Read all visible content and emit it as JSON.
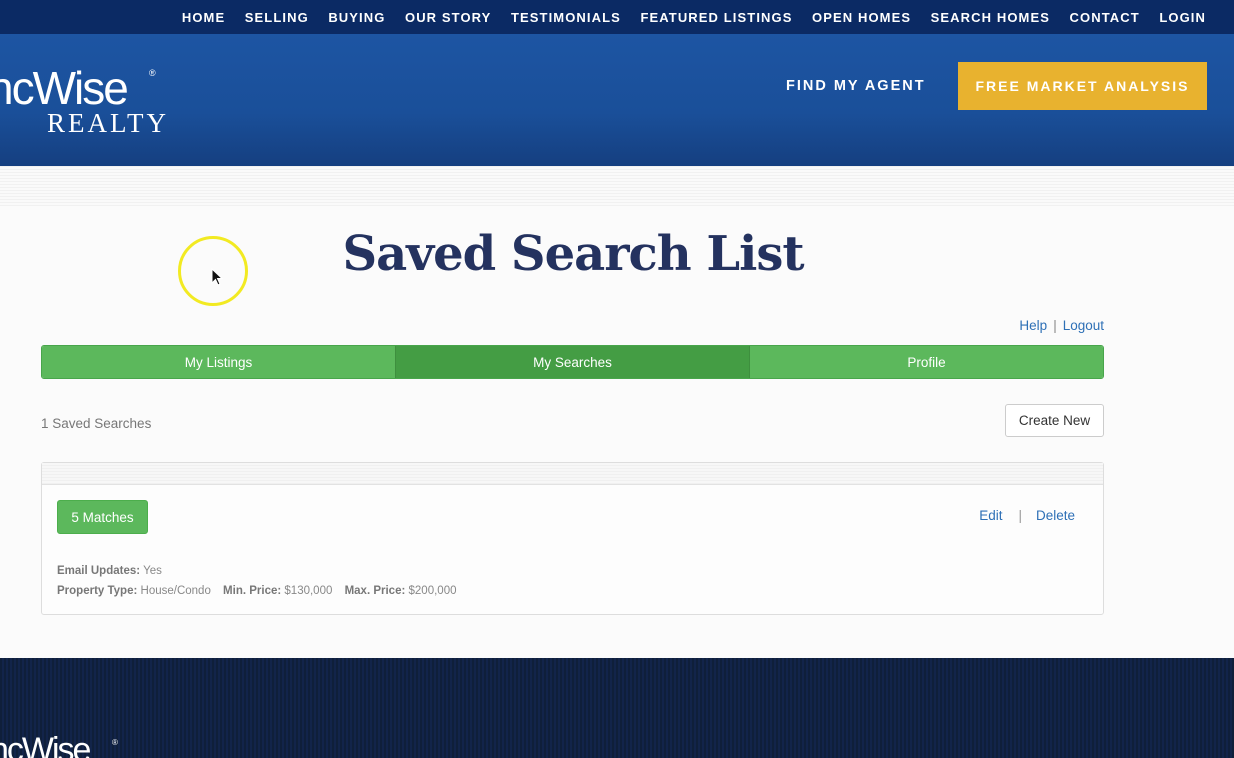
{
  "topnav": {
    "items": [
      "HOME",
      "SELLING",
      "BUYING",
      "OUR STORY",
      "TESTIMONIALS",
      "FEATURED LISTINGS",
      "OPEN HOMES",
      "SEARCH HOMES",
      "CONTACT",
      "LOGIN"
    ]
  },
  "header": {
    "logo_word": "ncWise",
    "logo_sub": "REALTY",
    "logo_reg": "®",
    "find_agent": "FIND MY AGENT",
    "free_market_analysis": "FREE MARKET ANALYSIS"
  },
  "page": {
    "title": "Saved Search List",
    "help": "Help",
    "separator": "|",
    "logout": "Logout"
  },
  "tabs": [
    {
      "label": "My Listings",
      "active": false
    },
    {
      "label": "My Searches",
      "active": true
    },
    {
      "label": "Profile",
      "active": false
    }
  ],
  "searches": {
    "count_label": "1 Saved Searches",
    "create_new": "Create New",
    "items": [
      {
        "matches": "5 Matches",
        "edit": "Edit",
        "sep": "|",
        "delete": "Delete",
        "email_updates_label": "Email Updates:",
        "email_updates_value": "Yes",
        "property_type_label": "Property Type:",
        "property_type_value": "House/Condo",
        "min_price_label": "Min. Price:",
        "min_price_value": "$130,000",
        "max_price_label": "Max. Price:",
        "max_price_value": "$200,000"
      }
    ]
  },
  "footer": {
    "logo_word": "ncWise",
    "logo_reg": "®"
  },
  "colors": {
    "nav_bg": "#0b2a64",
    "header_blue": "#1a4f99",
    "accent_gold": "#e8b22f",
    "tab_green": "#5cb85c",
    "tab_active_green": "#449d44",
    "link_blue": "#2e70b6",
    "title_navy": "#24325f"
  }
}
